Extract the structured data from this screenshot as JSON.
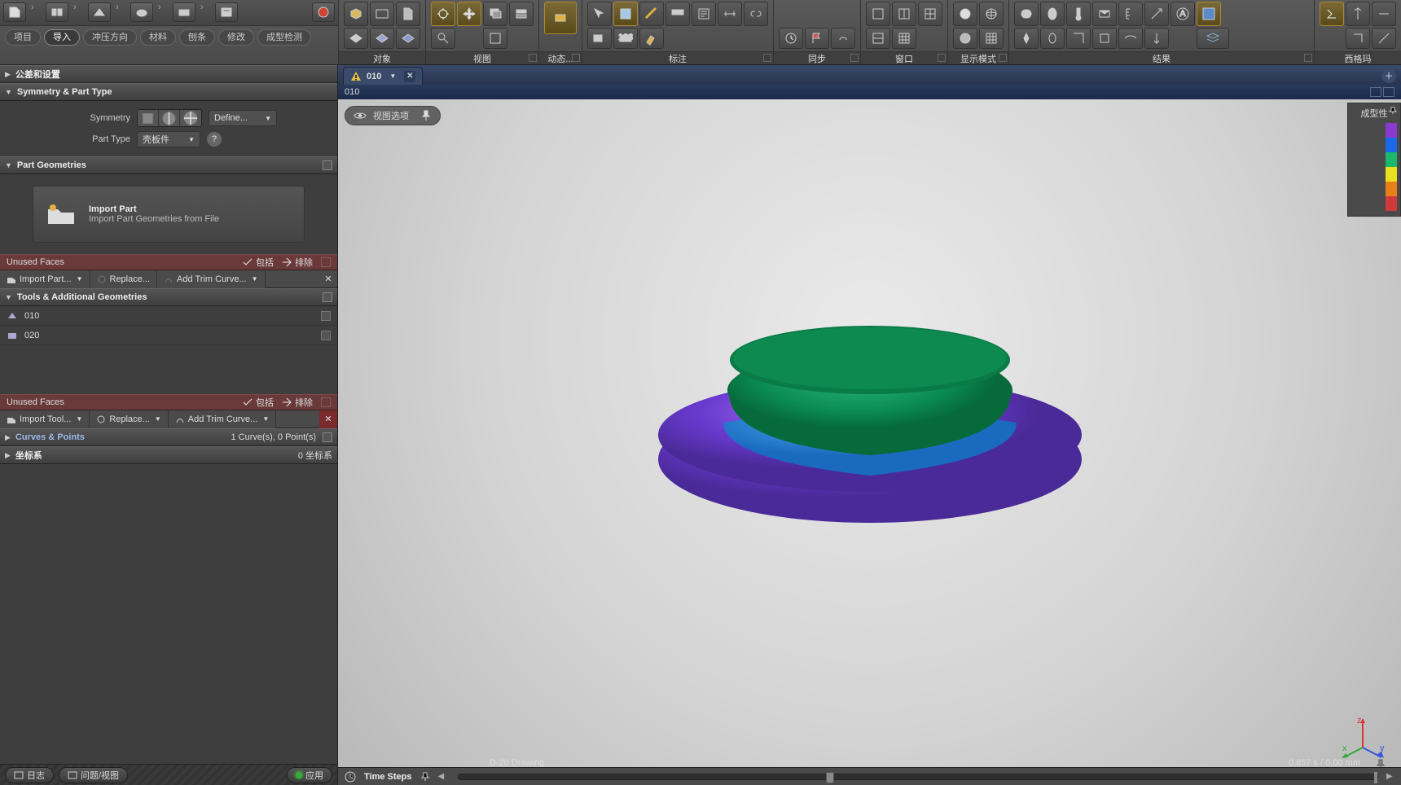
{
  "ribbon_left_pills": [
    "项目",
    "导入",
    "冲压方向",
    "材料",
    "刨条",
    "修改",
    "成型检测"
  ],
  "ribbon_left_active_pill_index": 1,
  "ribbon_groups": [
    "对象",
    "视图",
    "动态...",
    "标注",
    "同步",
    "窗口",
    "显示模式",
    "结果",
    "西格玛"
  ],
  "sidebar": {
    "tolerance_header": "公差和设置",
    "symmetry_header": "Symmetry & Part Type",
    "symmetry_label": "Symmetry",
    "symmetry_define": "Define...",
    "parttype_label": "Part Type",
    "parttype_value": "壳板件",
    "partgeo_header": "Part Geometries",
    "import_title": "Import Part",
    "import_sub": "Import Part Geometries from File",
    "unused_faces": "Unused Faces",
    "chip_include": "包括",
    "chip_exclude": "排除",
    "import_part_btn": "Import Part...",
    "replace_btn": "Replace...",
    "add_trim_btn": "Add Trim Curve...",
    "tools_header": "Tools & Additional Geometries",
    "tool_items": [
      "010",
      "020"
    ],
    "import_tool_btn": "Import Tool...",
    "curves_header": "Curves & Points",
    "curves_info": "1 Curve(s), 0 Point(s)",
    "coord_header": "坐标系",
    "coord_info": "0 坐标系",
    "log_btn": "日志",
    "issue_btn": "问题/视图",
    "apply_btn": "应用"
  },
  "tab": {
    "name": "010"
  },
  "view_title": "010",
  "float_pill": "视图选项",
  "legend": {
    "title": "成型性",
    "colors": [
      "#8a3ad0",
      "#1a6ae8",
      "#1ab86a",
      "#e8e020",
      "#e8801a",
      "#d03a3a"
    ]
  },
  "footer_label": "D-20 Drawing",
  "footer_info": "0.857 s / 0.00 mm",
  "timebar_label": "Time Steps"
}
